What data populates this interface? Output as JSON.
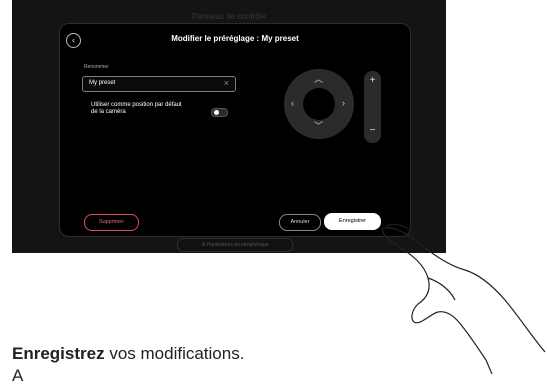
{
  "background_title": "Panneau de contrôle",
  "dialog": {
    "title": "Modifier le préréglage : My preset",
    "rename_label": "Renommer",
    "name_value": "My preset",
    "default_position_label": "Utiliser comme position par défaut de la caméra",
    "default_position_on": false
  },
  "zoom": {
    "plus": "+",
    "minus": "−"
  },
  "buttons": {
    "delete": "Supprimer",
    "cancel": "Annuler",
    "save": "Enregistrer"
  },
  "device_settings_label": "Paramètres du périphérique",
  "caption": {
    "bold": "Enregistrez",
    "rest": " vos modifications.",
    "line2": "A"
  },
  "colors": {
    "panel_bg": "#000000",
    "delete_accent": "#d9525e",
    "save_bg": "#ffffff"
  },
  "icons": [
    "back-icon",
    "clear-icon",
    "arrow-up-icon",
    "arrow-down-icon",
    "arrow-left-icon",
    "arrow-right-icon",
    "gear-icon",
    "hand-pointer-icon"
  ]
}
